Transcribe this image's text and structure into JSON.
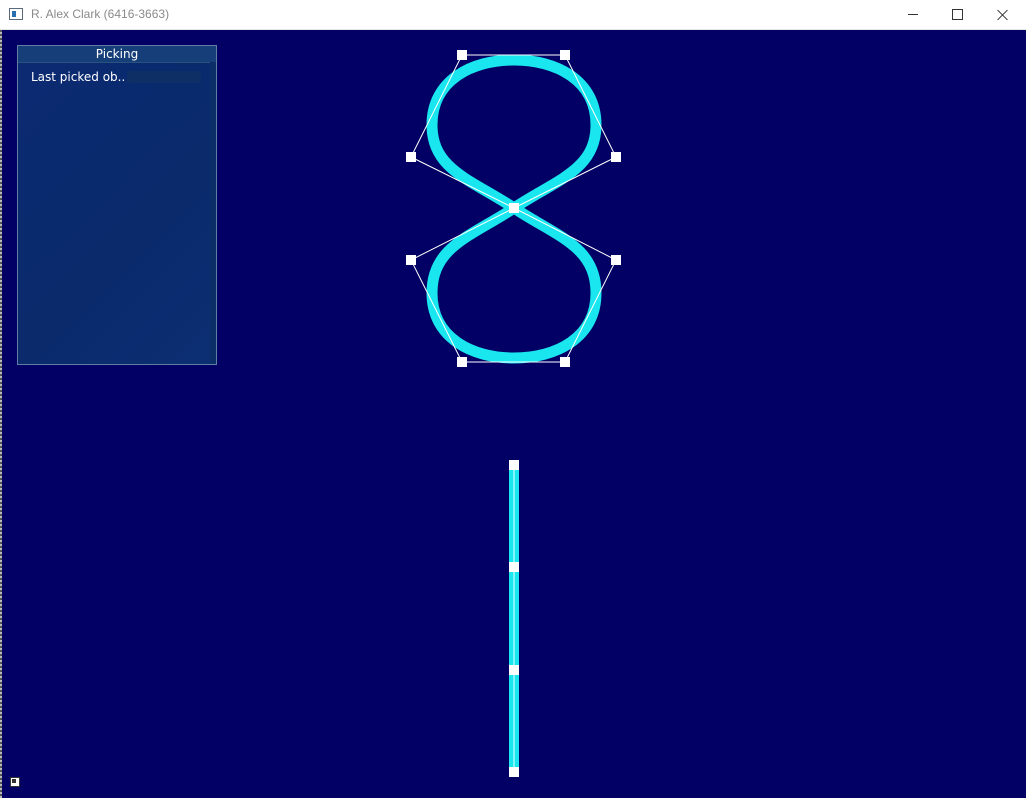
{
  "window": {
    "title": "R. Alex Clark (6416-3663)"
  },
  "picking_panel": {
    "title": "Picking",
    "last_picked_label": "Last picked ob.."
  },
  "colors": {
    "background": "#020064",
    "curve": "#19e6ee",
    "control_point": "#ffffff",
    "control_polygon": "#ffffff"
  },
  "icons": {
    "app": "window-app-icon",
    "minimize": "minimize-icon",
    "maximize": "maximize-icon",
    "close": "close-icon",
    "corner": "help-corner-icon"
  }
}
